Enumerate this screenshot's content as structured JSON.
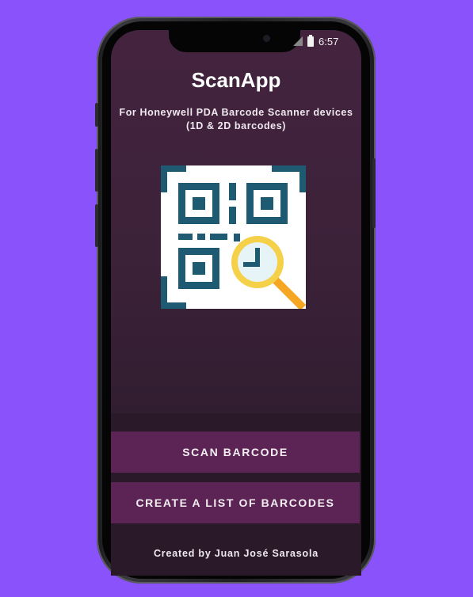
{
  "status_bar": {
    "time": "6:57"
  },
  "app": {
    "title": "ScanApp",
    "subtitle": "For Honeywell PDA Barcode Scanner devices (1D & 2D barcodes)",
    "logo_icon": "qr-code-magnifier-icon"
  },
  "buttons": {
    "scan_label": "SCAN BARCODE",
    "list_label": "CREATE A LIST OF BARCODES"
  },
  "footer": {
    "credit": "Created by Juan José Sarasola"
  },
  "colors": {
    "background": "#8a52fb",
    "screen": "#3c2239",
    "button": "#5c2454",
    "qr": "#1e5a72",
    "magnifier": "#f5d14a",
    "handle": "#f5a623"
  }
}
